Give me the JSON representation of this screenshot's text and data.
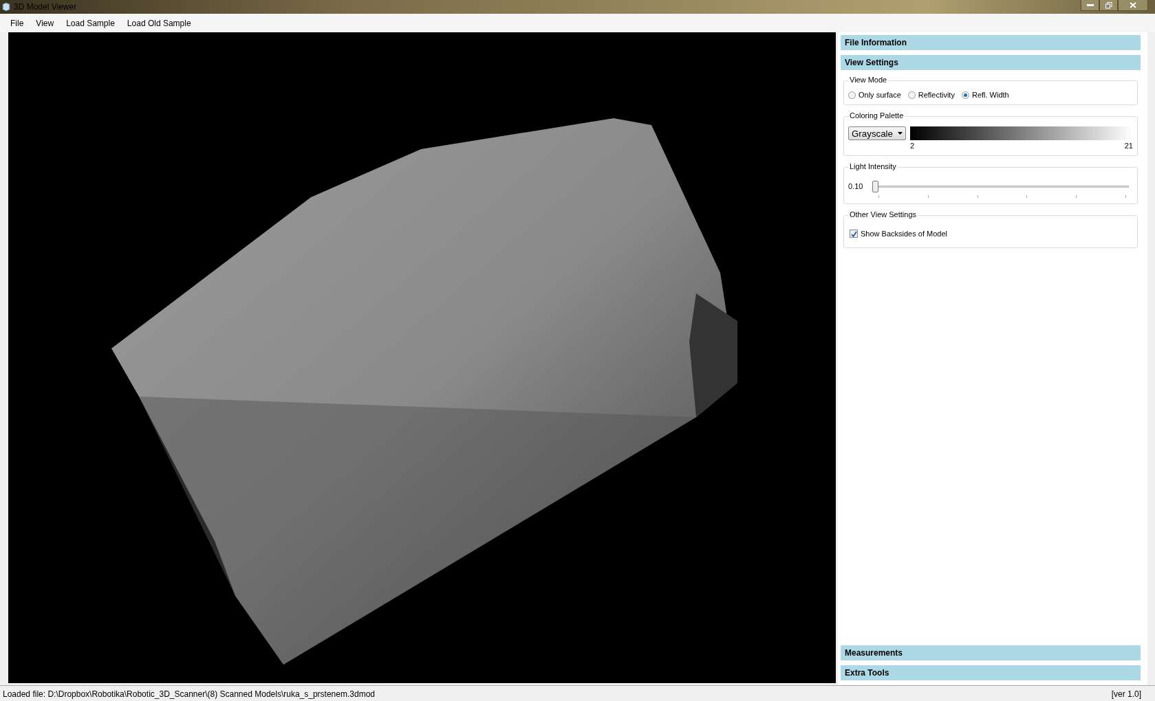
{
  "window": {
    "title": "3D Model Viewer"
  },
  "menu": [
    "File",
    "View",
    "Load Sample",
    "Load Old Sample"
  ],
  "panel": {
    "sections_top": [
      {
        "title": "File Information"
      },
      {
        "title": "View Settings"
      }
    ],
    "view_mode": {
      "title": "View Mode",
      "options": [
        {
          "label": "Only surface",
          "selected": false
        },
        {
          "label": "Reflectivity",
          "selected": false
        },
        {
          "label": "Refl. Width",
          "selected": true
        }
      ]
    },
    "coloring_palette": {
      "title": "Coloring Palette",
      "dropdown": "Grayscale",
      "min": "2",
      "max": "21"
    },
    "light_intensity": {
      "title": "Light Intensity",
      "reading": "0.10",
      "level": 0.0
    },
    "other": {
      "title": "Other View Settings",
      "checkbox": {
        "label": "Show Backsides of Model",
        "checked": true
      }
    },
    "sections_bottom": [
      {
        "title": "Measurements"
      },
      {
        "title": "Extra Tools"
      }
    ]
  },
  "status_bar": {
    "file": "Loaded file: D:\\Dropbox\\Robotika\\Robotic_3D_Scanner\\(8) Scanned Models\\ruka_s_prstenem.3dmod",
    "version": "[ver 1.0]"
  }
}
